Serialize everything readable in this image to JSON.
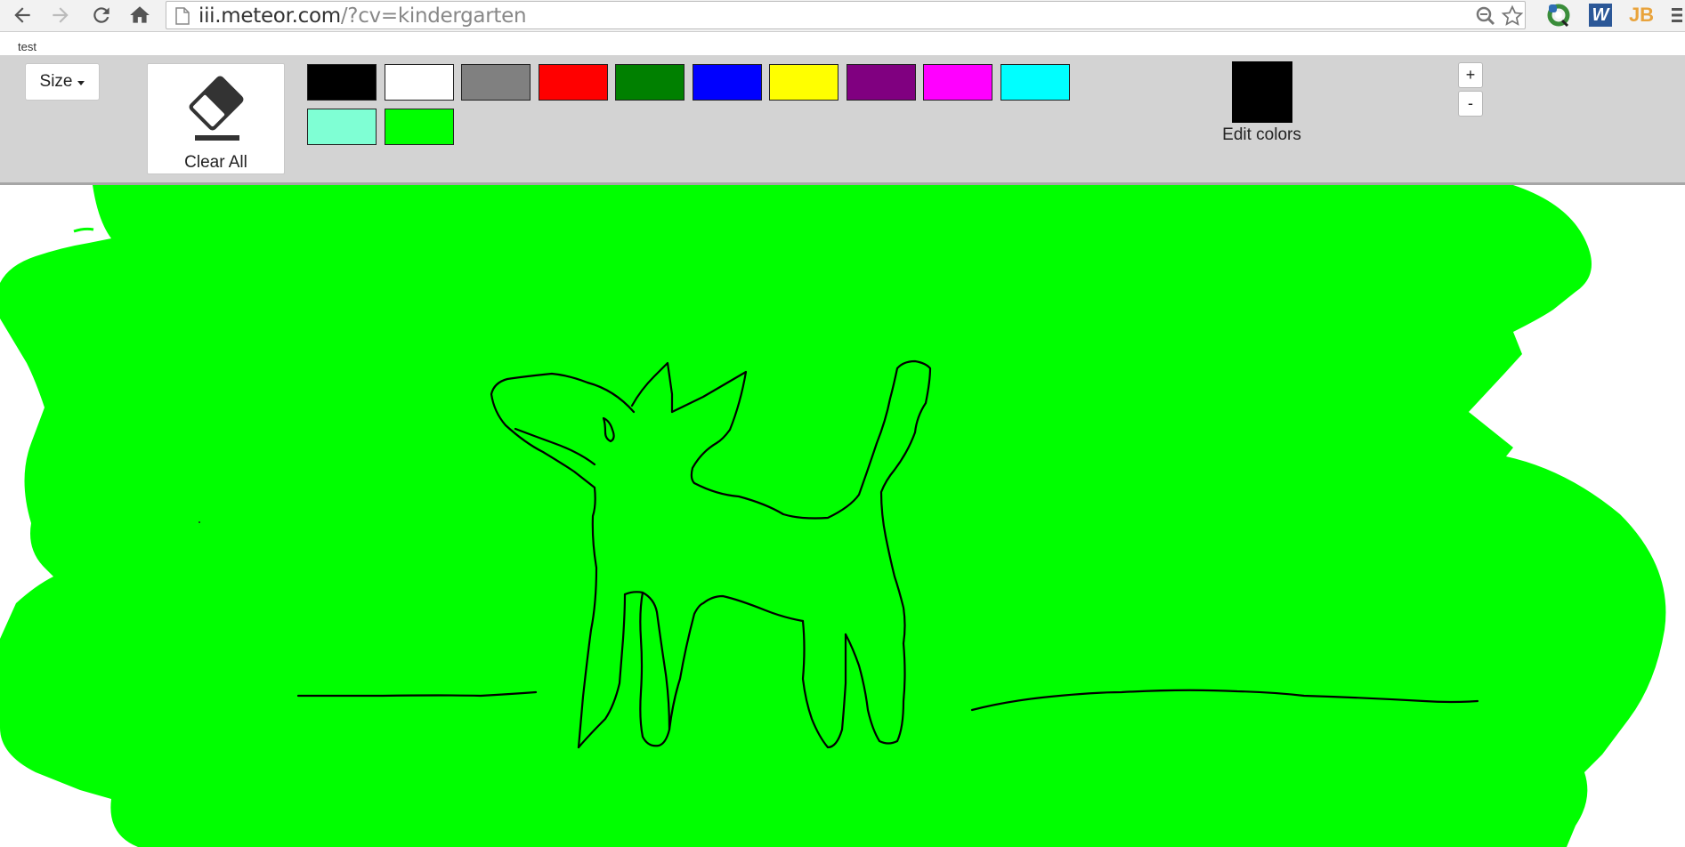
{
  "browser": {
    "url_host": "iii.meteor.com",
    "url_rest": "/?cv=kindergarten",
    "icons": {
      "back": "back-arrow-icon",
      "forward": "forward-arrow-icon",
      "reload": "reload-icon",
      "home": "home-icon",
      "page": "page-icon",
      "zoom": "magnifier-icon",
      "bookmark": "star-icon"
    },
    "extensions": {
      "ext_1": "ring-extension-icon",
      "ext_2": {
        "label": "W",
        "color": "#2b5797"
      },
      "ext_3": {
        "label": "JB",
        "color": "#e9a33b"
      }
    }
  },
  "page": {
    "tab_label": "test"
  },
  "toolbar": {
    "size_label": "Size",
    "clear_all_label": "Clear All",
    "edit_colors_label": "Edit colors",
    "current_color": "#000000",
    "zoom_in_label": "+",
    "zoom_out_label": "-",
    "palette": [
      "#000000",
      "#ffffff",
      "#808080",
      "#ff0000",
      "#008000",
      "#0000ff",
      "#ffff00",
      "#800080",
      "#ff00ff",
      "#00ffff",
      "#7fffd4",
      "#00ff00"
    ]
  },
  "canvas": {
    "fill_color": "#00ff00",
    "stroke_color": "#000000",
    "drawing": "dog"
  }
}
